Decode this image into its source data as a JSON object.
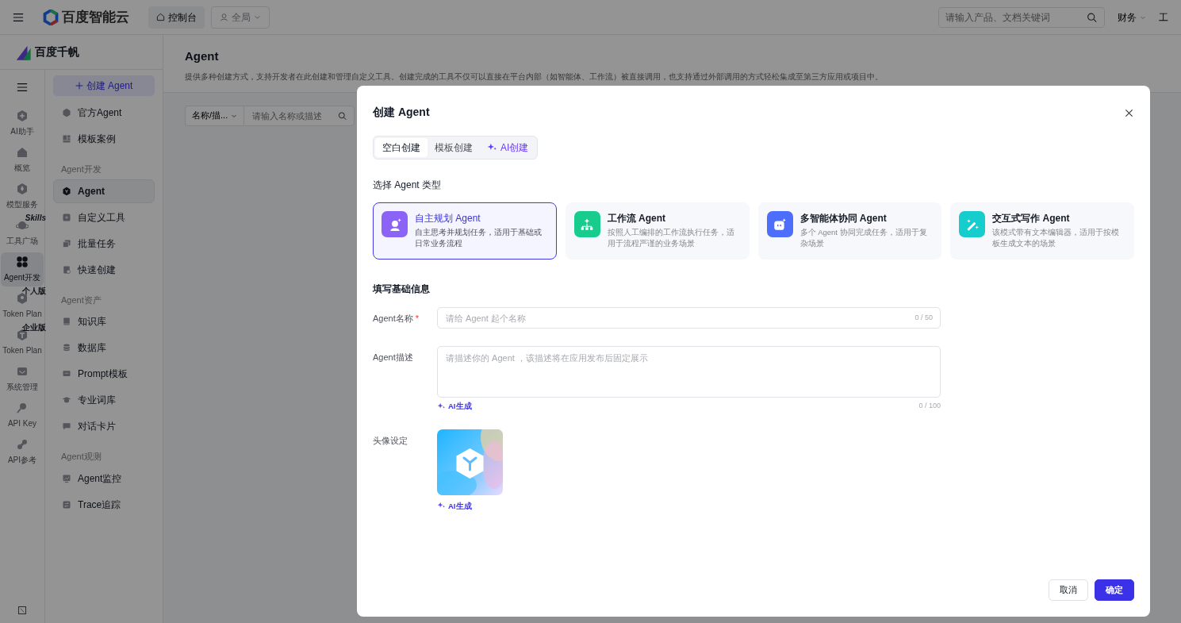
{
  "topbar": {
    "brand": "百度智能云",
    "console_tab": "控制台",
    "scope": "全局",
    "search": {
      "placeholder": "请输入产品、文档关键词"
    },
    "menus": [
      {
        "label": "财务",
        "dropdown": true
      },
      {
        "label": "工",
        "dropdown": false
      }
    ]
  },
  "rail": {
    "items": [
      {
        "label": "AI助手",
        "selected": false
      },
      {
        "label": "概览",
        "selected": false
      },
      {
        "label": "模型服务",
        "selected": false
      },
      {
        "label": "工具广场",
        "badge": "Skills",
        "selected": false
      },
      {
        "label": "Agent开发",
        "selected": true
      },
      {
        "label": "Token Plan",
        "badge": "个人版",
        "selected": false
      },
      {
        "label": "Token Plan",
        "badge": "企业版",
        "selected": false
      },
      {
        "label": "系统管理",
        "selected": false
      },
      {
        "label": "API Key",
        "selected": false
      },
      {
        "label": "API参考",
        "selected": false
      }
    ]
  },
  "sidebar": {
    "logo": "百度千帆",
    "create_button": "创建 Agent",
    "sections": [
      {
        "items": [
          {
            "label": "官方Agent",
            "selected": false
          },
          {
            "label": "模板案例",
            "selected": false
          }
        ]
      },
      {
        "heading": "Agent开发",
        "items": [
          {
            "label": "Agent",
            "selected": true
          },
          {
            "label": "自定义工具",
            "selected": false
          },
          {
            "label": "批量任务",
            "selected": false
          },
          {
            "label": "快速创建",
            "selected": false
          }
        ]
      },
      {
        "heading": "Agent资产",
        "items": [
          {
            "label": "知识库",
            "selected": false
          },
          {
            "label": "数据库",
            "selected": false
          },
          {
            "label": "Prompt模板",
            "selected": false
          },
          {
            "label": "专业词库",
            "selected": false
          },
          {
            "label": "对话卡片",
            "selected": false
          }
        ]
      },
      {
        "heading": "Agent观测",
        "items": [
          {
            "label": "Agent监控",
            "selected": false
          },
          {
            "label": "Trace追踪",
            "selected": false
          }
        ]
      }
    ]
  },
  "page": {
    "title": "Agent",
    "description": "提供多种创建方式，支持开发者在此创建和管理自定义工具。创建完成的工具不仅可以直接在平台内部（如智能体、工作流）被直接调用，也支持通过外部调用的方式轻松集成至第三方应用或项目中。",
    "filter": {
      "field": "名称/描...",
      "placeholder": "请输入名称或描述"
    }
  },
  "modal": {
    "title": "创建 Agent",
    "tabs": [
      {
        "label": "空白创建",
        "kind": "plain",
        "selected": true
      },
      {
        "label": "模板创建",
        "kind": "plain",
        "selected": false
      },
      {
        "label": "AI创建",
        "kind": "ai",
        "selected": false
      }
    ],
    "type_heading": "选择 Agent 类型",
    "types": [
      {
        "name": "自主规划 Agent",
        "description": "自主思考并规划任务，适用于基础或日常业务流程",
        "color": "#8b63f6",
        "selected": true
      },
      {
        "name": "工作流 Agent",
        "description": "按照人工编排的工作流执行任务，适用于流程严谨的业务场景",
        "color": "#17cc8d",
        "selected": false
      },
      {
        "name": "多智能体协同 Agent",
        "description": "多个 Agent 协同完成任务，适用于复杂场景",
        "color": "#4d6dfb",
        "selected": false
      },
      {
        "name": "交互式写作 Agent",
        "description": "该模式带有文本编辑器，适用于按模板生成文本的场景",
        "color": "#15cdcc",
        "selected": false
      }
    ],
    "form_heading": "填写基础信息",
    "fields": [
      {
        "kind": "input",
        "label": "Agent名称",
        "required_mark": "*",
        "placeholder": "请给 Agent 起个名称",
        "counter": "0 / 50"
      },
      {
        "kind": "textarea",
        "label": "Agent描述",
        "placeholder": "请描述你的 Agent ，该描述将在应用发布后固定展示",
        "counter": "0 / 100",
        "ai_action": "AI生成"
      },
      {
        "kind": "avatar",
        "label": "头像设定",
        "ai_action": "AI生成"
      }
    ],
    "buttons": [
      {
        "label": "取消",
        "kind": "secondary"
      },
      {
        "label": "确定",
        "kind": "primary"
      }
    ]
  }
}
